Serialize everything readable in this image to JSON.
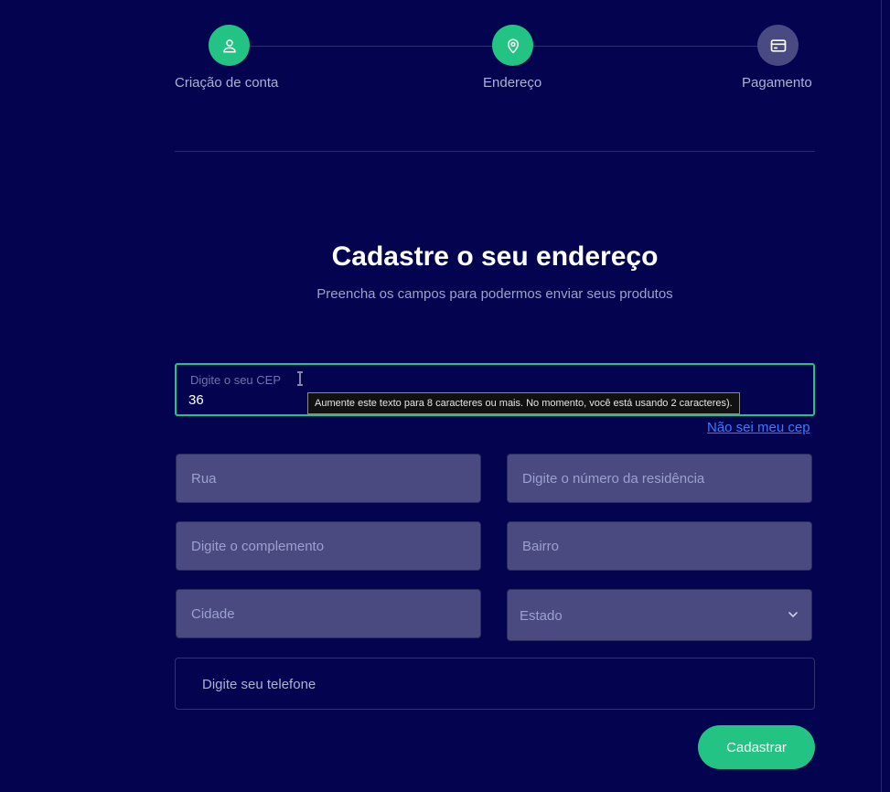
{
  "stepper": {
    "steps": [
      {
        "label": "Criação de conta",
        "icon": "user-icon",
        "state": "done"
      },
      {
        "label": "Endereço",
        "icon": "map-pin-icon",
        "state": "done"
      },
      {
        "label": "Pagamento",
        "icon": "credit-card-icon",
        "state": "pending"
      }
    ]
  },
  "header": {
    "title": "Cadastre o seu endereço",
    "subtitle": "Preencha os campos para podermos enviar seus produtos"
  },
  "cep": {
    "label": "Digite o seu CEP",
    "value": "36",
    "tooltip": "Aumente este texto para 8 caracteres ou mais. No momento, você está usando 2 caracteres).",
    "help_link": "Não sei meu cep"
  },
  "fields": {
    "street": "Rua",
    "number": "Digite o número da residência",
    "complement": "Digite o complemento",
    "neighborhood": "Bairro",
    "city": "Cidade",
    "state": "Estado",
    "phone": "Digite seu telefone"
  },
  "actions": {
    "submit": "Cadastrar"
  },
  "colors": {
    "background": "#03034f",
    "accent": "#23c483",
    "input_bg": "#4a4a80",
    "link": "#3b7bff"
  }
}
